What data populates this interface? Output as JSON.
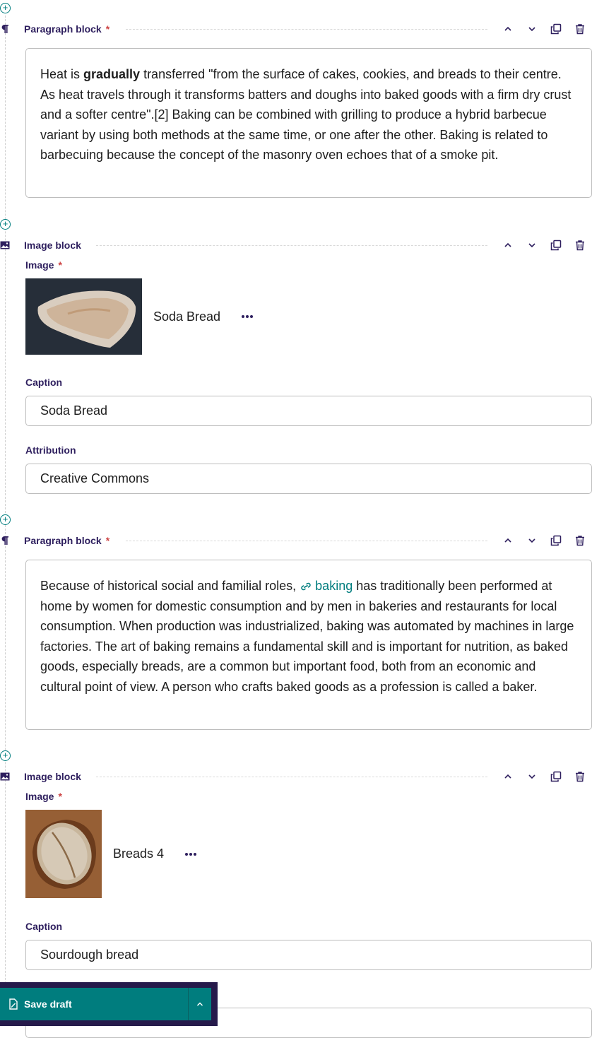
{
  "blocks": [
    {
      "type": "paragraph",
      "title": "Paragraph block",
      "required": "*",
      "body": {
        "pre": "Heat is ",
        "bold": "gradually",
        "post": " transferred \"from the surface of cakes, cookies, and breads to their centre. As heat travels through it transforms batters and doughs into baked goods with a firm dry crust and a softer centre\".[2] Baking can be combined with grilling to produce a hybrid barbecue variant by using both methods at the same time, or one after the other. Baking is related to barbecuing because the concept of the masonry oven echoes that of a smoke pit."
      }
    },
    {
      "type": "image",
      "title": "Image block",
      "image_label": "Image",
      "required": "*",
      "image_title": "Soda Bread",
      "caption_label": "Caption",
      "caption_value": "Soda Bread",
      "attribution_label": "Attribution",
      "attribution_value": "Creative Commons"
    },
    {
      "type": "paragraph",
      "title": "Paragraph block",
      "required": "*",
      "body": {
        "pre": "Because of historical social and familial roles, ",
        "link": "baking",
        "post": " has traditionally been performed at home by women for domestic consumption and by men in bakeries and restaurants for local consumption. When production was industrialized, baking was automated by machines in large factories. The art of baking remains a fundamental skill and is important for nutrition, as baked goods, especially breads, are a common but important food, both from an economic and cultural point of view. A person who crafts baked goods as a profession is called a baker."
      }
    },
    {
      "type": "image",
      "title": "Image block",
      "image_label": "Image",
      "required": "*",
      "image_title": "Breads 4",
      "caption_label": "Caption",
      "caption_value": "Sourdough bread"
    }
  ],
  "footer": {
    "save_label": "Save draft"
  },
  "icons": {
    "add": "plus-circle-icon",
    "paragraph": "pilcrow-icon",
    "image": "image-icon",
    "move_up": "chevron-up-icon",
    "move_down": "chevron-down-icon",
    "duplicate": "copy-icon",
    "delete": "bin-icon",
    "save": "draft-icon"
  },
  "colors": {
    "accent": "#007d7e",
    "label": "#2e1f5e",
    "required": "#cd4444",
    "footer_bg": "#261a4b"
  }
}
